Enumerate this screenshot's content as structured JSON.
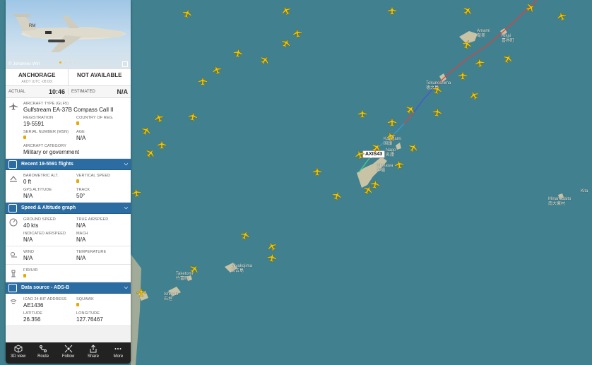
{
  "photo": {
    "credit": "© Johannes Wirl"
  },
  "route": {
    "origin_code": "ANCHORAGE",
    "origin_sub": "AKDT (UTC -08:00)",
    "destination_code": "NOT AVAILABLE"
  },
  "times": {
    "actual_label": "ACTUAL",
    "actual_value": "10:46",
    "estimated_label": "ESTIMATED",
    "estimated_value": "N/A"
  },
  "aircraft": {
    "type_label": "AIRCRAFT TYPE (GLF5)",
    "type_value": "Gulfstream EA-37B Compass Call II",
    "registration_label": "REGISTRATION",
    "registration_value": "19-5591",
    "country_label": "COUNTRY OF REG.",
    "serial_label": "SERIAL NUMBER (MSN)",
    "age_label": "AGE",
    "age_value": "N/A",
    "category_label": "AIRCRAFT CATEGORY",
    "category_value": "Military or government"
  },
  "recent_bar": {
    "label": "Recent 19-5591 flights"
  },
  "altitude": {
    "baro_label": "BAROMETRIC ALT.",
    "baro_value": "0 ft",
    "vspeed_label": "VERTICAL SPEED",
    "gps_label": "GPS ALTITUDE",
    "gps_value": "N/A",
    "track_label": "TRACK",
    "track_value": "50°"
  },
  "speed_bar": {
    "label": "Speed & Altitude graph"
  },
  "speed": {
    "ground_label": "GROUND SPEED",
    "ground_value": "40 kts",
    "true_label": "TRUE AIRSPEED",
    "true_value": "N/A",
    "indicated_label": "INDICATED AIRSPEED",
    "indicated_value": "N/A",
    "mach_label": "MACH",
    "mach_value": "N/A"
  },
  "weather": {
    "wind_label": "WIND",
    "wind_value": "N/A",
    "temp_label": "TEMPERATURE",
    "temp_value": "N/A"
  },
  "fir": {
    "label": "FIR/UIR"
  },
  "source_bar": {
    "label": "Data source - ADS-B"
  },
  "transponder": {
    "icao_label": "ICAO 24-BIT ADDRESS",
    "icao_value": "AE1436",
    "squawk_label": "SQUAWK",
    "lat_label": "LATITUDE",
    "lat_value": "26.356",
    "lon_label": "LONGITUDE",
    "lon_value": "127.76467"
  },
  "toolbar": {
    "view3d": "3D view",
    "route": "Route",
    "follow": "Follow",
    "share": "Share",
    "more": "More"
  },
  "map": {
    "callsign": "AXIS43",
    "labels": {
      "amami": "Amami\n奄美",
      "kikai": "Kikai\n喜界町",
      "tokunoshima": "Tokunoshima\n徳之島",
      "kunigami": "Kunigami\n国頭",
      "nago": "Nago\n名護",
      "okinawa": "Okinawa\n沖縄",
      "miyakojima": "Miyakojima\n宮古島",
      "taketomi": "Taketomi\n竹富町",
      "ishigaki": "Ishigaki\n石垣",
      "minamidaito": "Minamidaito\n南大東村",
      "kita": "Kita"
    },
    "colors": {
      "sea": "#40808f",
      "land": "#c9c3a6",
      "plane": "#f5c800"
    }
  }
}
